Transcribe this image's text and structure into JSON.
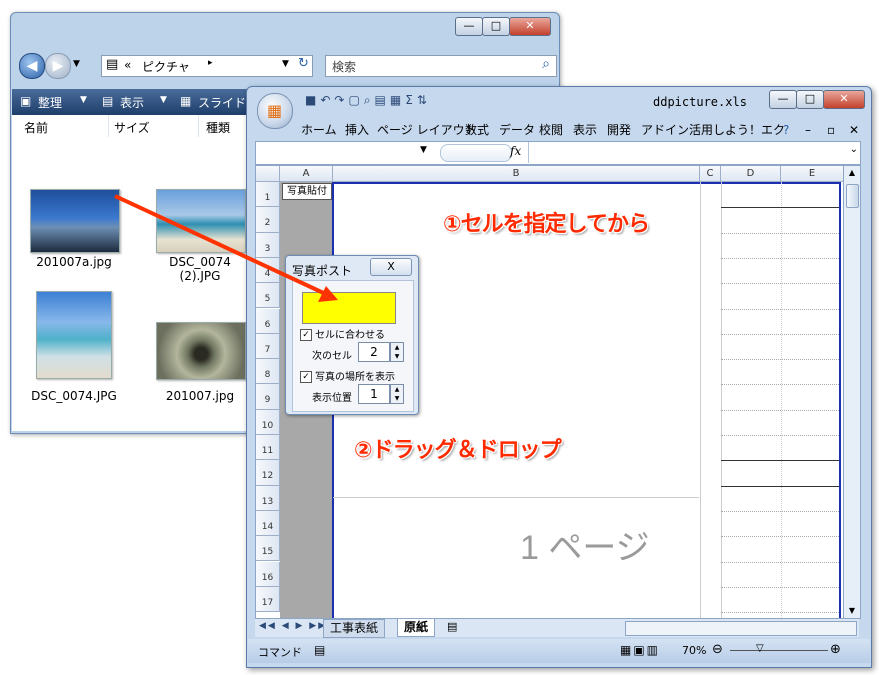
{
  "explorer": {
    "address_prefix": "«",
    "address_path": "ピクチャ",
    "search_placeholder": "検索",
    "toolbar": {
      "organize": "整理",
      "view": "表示",
      "slideshow": "スライド"
    },
    "columns": {
      "name": "名前",
      "size": "サイズ",
      "type": "種類"
    },
    "files": [
      {
        "name": "201007a.jpg"
      },
      {
        "name": "DSC_0074\n(2).JPG"
      },
      {
        "name": "DSC_0074.JPG"
      },
      {
        "name": "201007.jpg"
      }
    ]
  },
  "excel": {
    "title": "ddpicture.xls",
    "tabs": [
      "ホーム",
      "挿入",
      "ページ レイアウト",
      "数式",
      "データ",
      "校閲",
      "表示",
      "開発",
      "アドイン",
      "活用しよう！エク"
    ],
    "fx_label": "fx",
    "columns": [
      "A",
      "B",
      "C",
      "D",
      "E"
    ],
    "rows": [
      "1",
      "2",
      "3",
      "4",
      "5",
      "6",
      "7",
      "8",
      "9",
      "10",
      "11",
      "12",
      "13",
      "14",
      "15",
      "16",
      "17"
    ],
    "cell_button": "写真貼付",
    "page_label": "1 ページ",
    "sheets": [
      "工事表紙",
      "原紙"
    ],
    "status": "コマンド",
    "zoom": "70%"
  },
  "dialog": {
    "title": "写真ポスト",
    "close": "X",
    "fit_cell_label": "セルに合わせる",
    "fit_cell_checked": true,
    "next_cell_label": "次のセル",
    "next_cell_value": "2",
    "show_location_label": "写真の場所を表示",
    "show_location_checked": true,
    "position_label": "表示位置",
    "position_value": "1",
    "drop_zone_color": "#ffff00"
  },
  "annotations": {
    "step1": "①セルを指定してから",
    "step2": "②ドラッグ＆ドロップ",
    "arrow_color": "#ff3300"
  }
}
